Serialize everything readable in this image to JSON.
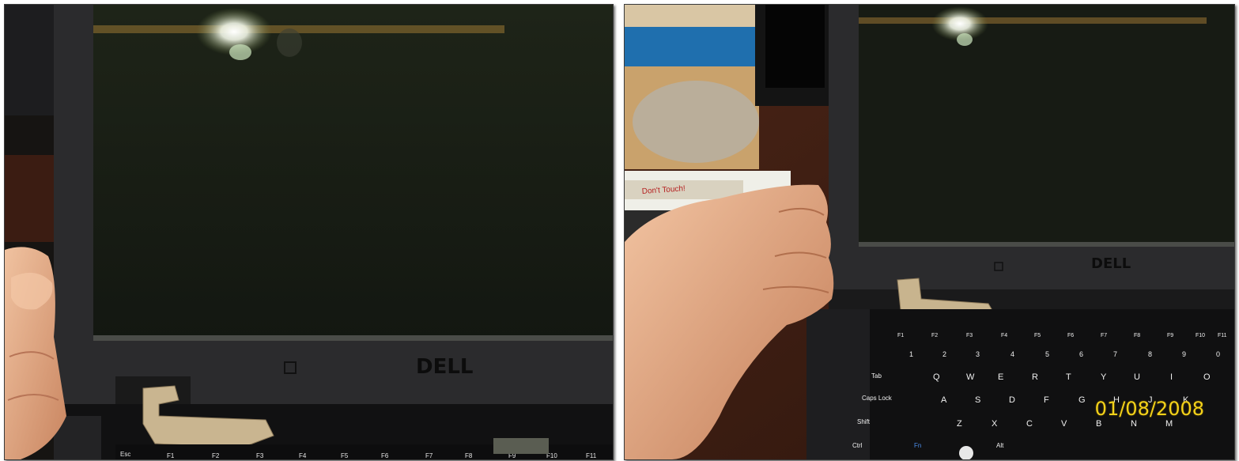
{
  "photos": [
    {
      "id_name": "left",
      "caption": "",
      "logo": "DELL",
      "keys": [
        "Esc",
        "F1",
        "F2",
        "F3",
        "F4",
        "F5",
        "F6",
        "F7",
        "F8",
        "F9",
        "F10",
        "F11"
      ]
    },
    {
      "id_name": "right",
      "caption": "",
      "logo": "DELL",
      "date_stamp": "01/08/2008",
      "sticker_text": "Don't Touch!",
      "keys": {
        "fn_row": [
          "F1",
          "F2",
          "F3",
          "F4",
          "F5",
          "F6",
          "F7",
          "F8",
          "F9",
          "F10",
          "F11"
        ],
        "num_row": [
          "1",
          "2",
          "3",
          "4",
          "5",
          "6",
          "7",
          "8",
          "9",
          "0"
        ],
        "q_row": [
          "Tab",
          "Q",
          "W",
          "E",
          "R",
          "T",
          "Y",
          "U",
          "I",
          "O"
        ],
        "a_row": [
          "Caps Lock",
          "A",
          "S",
          "D",
          "F",
          "G",
          "H",
          "J",
          "K"
        ],
        "z_row": [
          "Shift",
          "Z",
          "X",
          "C",
          "V",
          "B",
          "N",
          "M"
        ],
        "bottom_row": [
          "Ctrl",
          "Fn",
          "Alt"
        ]
      }
    }
  ],
  "colors": {
    "bezel": "#2a2a2c",
    "screen": "#161a14",
    "table_wood": "#3a1c12",
    "skin": "#e8b08e",
    "date_stamp": "#f3d21a"
  }
}
